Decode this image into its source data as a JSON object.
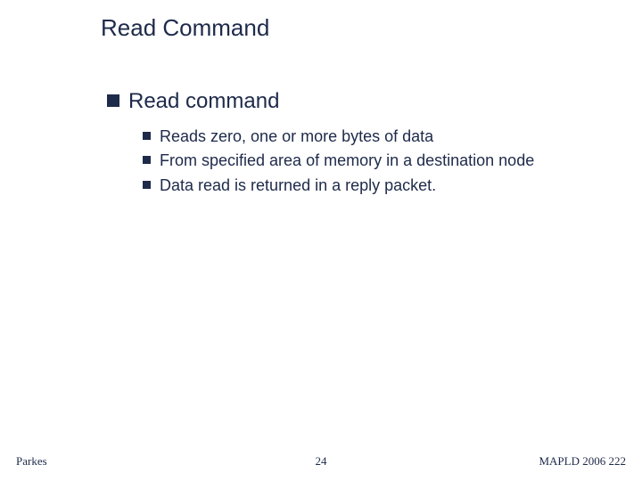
{
  "title": "Read Command",
  "content": {
    "heading": "Read command",
    "bullets": {
      "0": "Reads zero, one or more bytes of data",
      "1": "From specified area of memory in a destination node",
      "2": "Data read is returned in a reply packet."
    }
  },
  "footer": {
    "left": "Parkes",
    "center": "24",
    "right": "MAPLD 2006 222"
  }
}
